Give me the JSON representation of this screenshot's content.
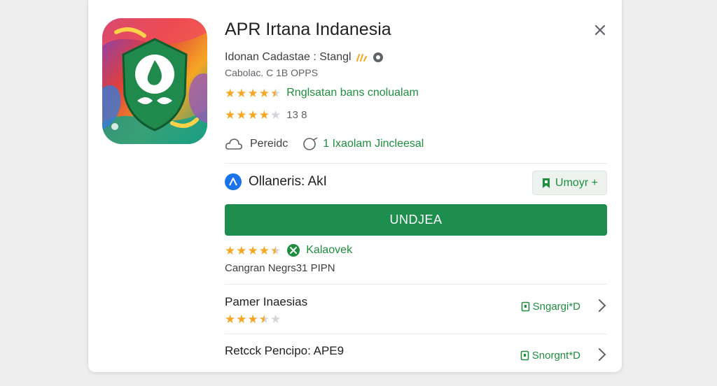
{
  "app": {
    "title": "APR Irtana Indanesia",
    "developer_line": "Idonan Cadastae : Stangl",
    "sub_line": "Cabolac. C 1B OPPS",
    "rating_row1": {
      "stars": 4.5,
      "text": "Rnglsatan bans cnolualam"
    },
    "rating_row2": {
      "stars": 4,
      "count": "13 8"
    },
    "meta": {
      "item1": "Pereidc",
      "item2": "1 Ixaolam Jincleesal"
    },
    "developer_name": "Ollaneris: AkI",
    "secondary_button": "Umoyr +",
    "install_button": "UNDJEA",
    "rating_row3": {
      "stars": 4.5,
      "badge_text": "Kalaovek"
    },
    "category_line": "Cangran Negrs31 PIPN"
  },
  "list": [
    {
      "title": "Pamer Inaesias",
      "stars": 3.5,
      "action": "Sngargi*D"
    },
    {
      "title": "Retcck Pencipo:  APE9",
      "action": "Snorgnt*D"
    }
  ],
  "icons": {
    "close": "close-icon",
    "share": "share-icon",
    "info": "info-icon",
    "cloud": "cloud-icon",
    "globe": "globe-icon",
    "dev_avatar": "developer-avatar-icon",
    "bookmark": "bookmark-icon",
    "verified": "verified-check-icon",
    "chevron": "chevron-right-icon"
  },
  "colors": {
    "accent_green": "#1e8e3e",
    "button_green": "#1e8e4e",
    "star": "#f5a623",
    "avatar_blue": "#1a73e8"
  }
}
